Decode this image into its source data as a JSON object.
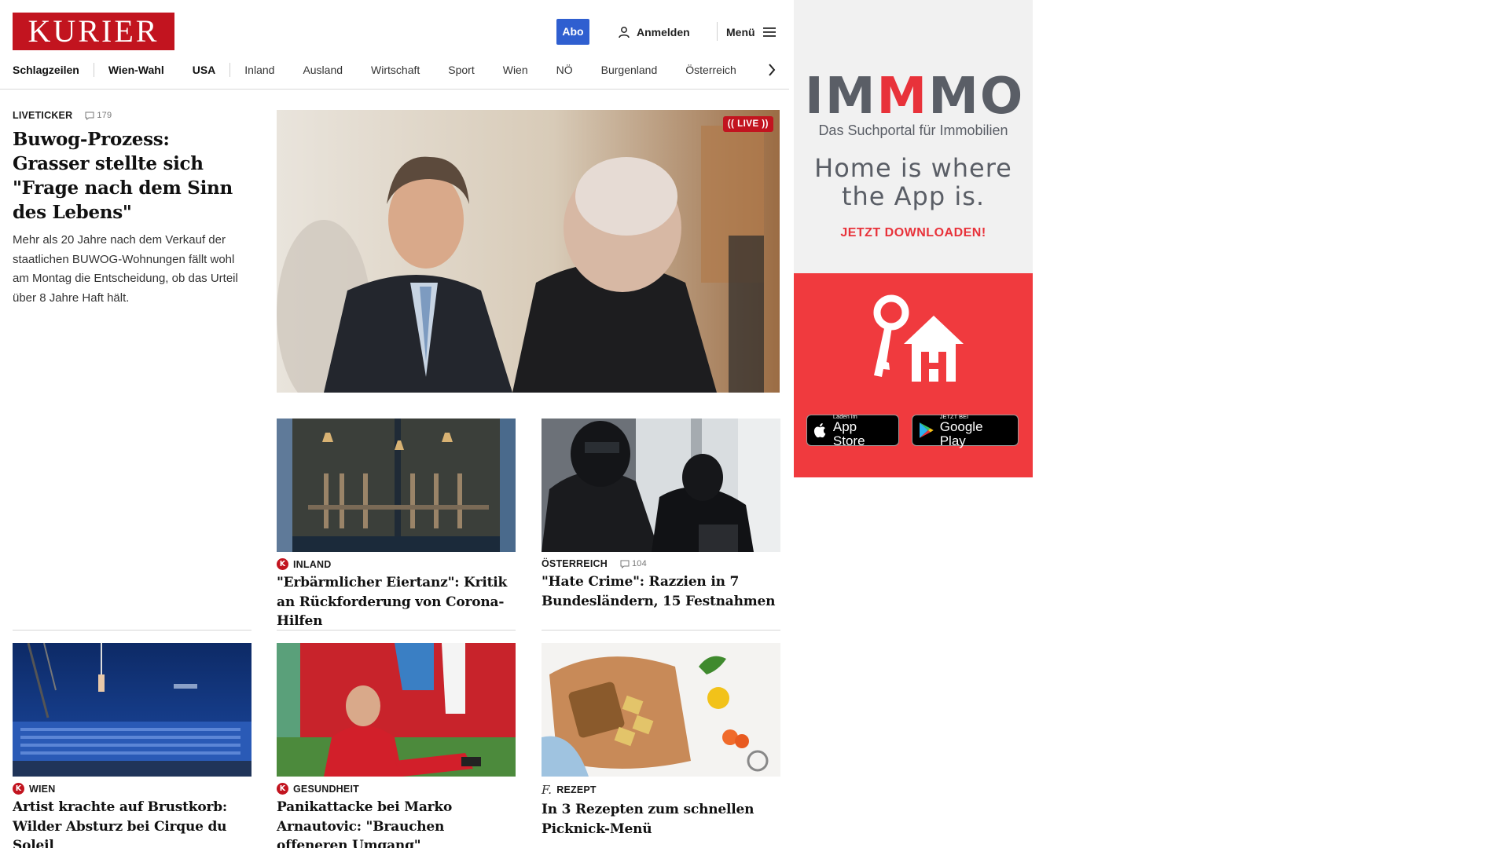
{
  "header": {
    "logo": "KURIER",
    "abo_label": "Abo",
    "login_label": "Anmelden",
    "menu_label": "Menü"
  },
  "nav": {
    "items": [
      "Schlagzeilen",
      "Wien-Wahl",
      "USA",
      "Inland",
      "Ausland",
      "Wirtschaft",
      "Sport",
      "Wien",
      "NÖ",
      "Burgenland",
      "Österreich"
    ]
  },
  "lead": {
    "kicker": "LIVETICKER",
    "comments": "179",
    "headline": "Buwog-Prozess: Grasser stellte sich \"Frage nach dem Sinn des Lebens\"",
    "teaser": "Mehr als 20 Jahre nach dem Verkauf der staatlichen BUWOG-Wohnungen fällt wohl am Montag die Entscheidung, ob das Urteil über 8 Jahre Haft hält.",
    "badge": "(( LIVE ))"
  },
  "cards": [
    {
      "kicker": "INLAND",
      "badge": "K",
      "headline": "\"Erbärmlicher Eiertanz\": Kritik an Rückforderung von Corona-Hilfen"
    },
    {
      "kicker": "ÖSTERREICH",
      "comments": "104",
      "headline": "\"Hate Crime\": Razzien in 7 Bundesländern, 15 Festnahmen"
    },
    {
      "kicker": "WIEN",
      "badge": "K",
      "headline": "Artist krachte auf Brustkorb: Wilder Absturz bei Cirque du Soleil"
    },
    {
      "kicker": "GESUNDHEIT",
      "badge": "K",
      "headline": "Panikattacke bei Marko Arnautovic: \"Brauchen offeneren Umgang\""
    },
    {
      "kicker": "REZEPT",
      "badge": "f.",
      "headline": "In 3 Rezepten zum schnellen Picknick-Menü"
    }
  ],
  "ad": {
    "brand_a": "IM",
    "brand_m": "M",
    "brand_b": "MO",
    "subtitle": "Das Suchportal für Immobilien",
    "tagline_1": "Home is where",
    "tagline_2": "the App is.",
    "cta": "JETZT DOWNLOADEN!",
    "appstore_small": "Laden im",
    "appstore_big": "App Store",
    "gplay_small": "JETZT BEI",
    "gplay_big": "Google Play"
  },
  "colors": {
    "brand_red": "#c2141f",
    "abo_blue": "#2f5fd0",
    "ad_red": "#f03a3e",
    "ad_grey": "#5a5e66"
  }
}
